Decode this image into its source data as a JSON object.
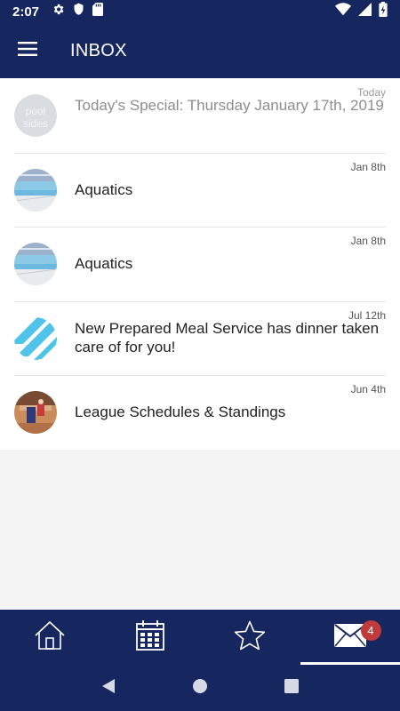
{
  "status_bar": {
    "time": "2:07",
    "left_icons": [
      "gear-icon",
      "shield-icon",
      "sd-card-icon"
    ],
    "right_icons": [
      "wifi-icon",
      "cellular-signal-icon",
      "battery-charging-icon"
    ]
  },
  "app_bar": {
    "title": "INBOX",
    "menu_icon": "hamburger-menu-icon"
  },
  "messages": [
    {
      "date": "Today",
      "title": "Today's Special: Thursday January 17th, 2019",
      "read": true,
      "avatar_text": "pool sides"
    },
    {
      "date": "Jan 8th",
      "title": "Aquatics",
      "read": false
    },
    {
      "date": "Jan 8th",
      "title": "Aquatics",
      "read": false
    },
    {
      "date": "Jul 12th",
      "title": "New Prepared Meal Service has dinner taken care of for you!",
      "read": false
    },
    {
      "date": "Jun 4th",
      "title": "League Schedules & Standings",
      "read": false
    }
  ],
  "bottom_nav": {
    "tabs": [
      {
        "name": "home",
        "icon": "home-icon"
      },
      {
        "name": "calendar",
        "icon": "calendar-icon"
      },
      {
        "name": "favorites",
        "icon": "star-icon"
      },
      {
        "name": "inbox",
        "icon": "envelope-icon",
        "badge": "4",
        "active": true
      }
    ]
  },
  "system_nav": [
    "back-icon",
    "home-circle-icon",
    "recents-icon"
  ],
  "colors": {
    "primary": "#16265f",
    "badge": "#c0393b",
    "accent_logo": "#4fc3e8"
  }
}
